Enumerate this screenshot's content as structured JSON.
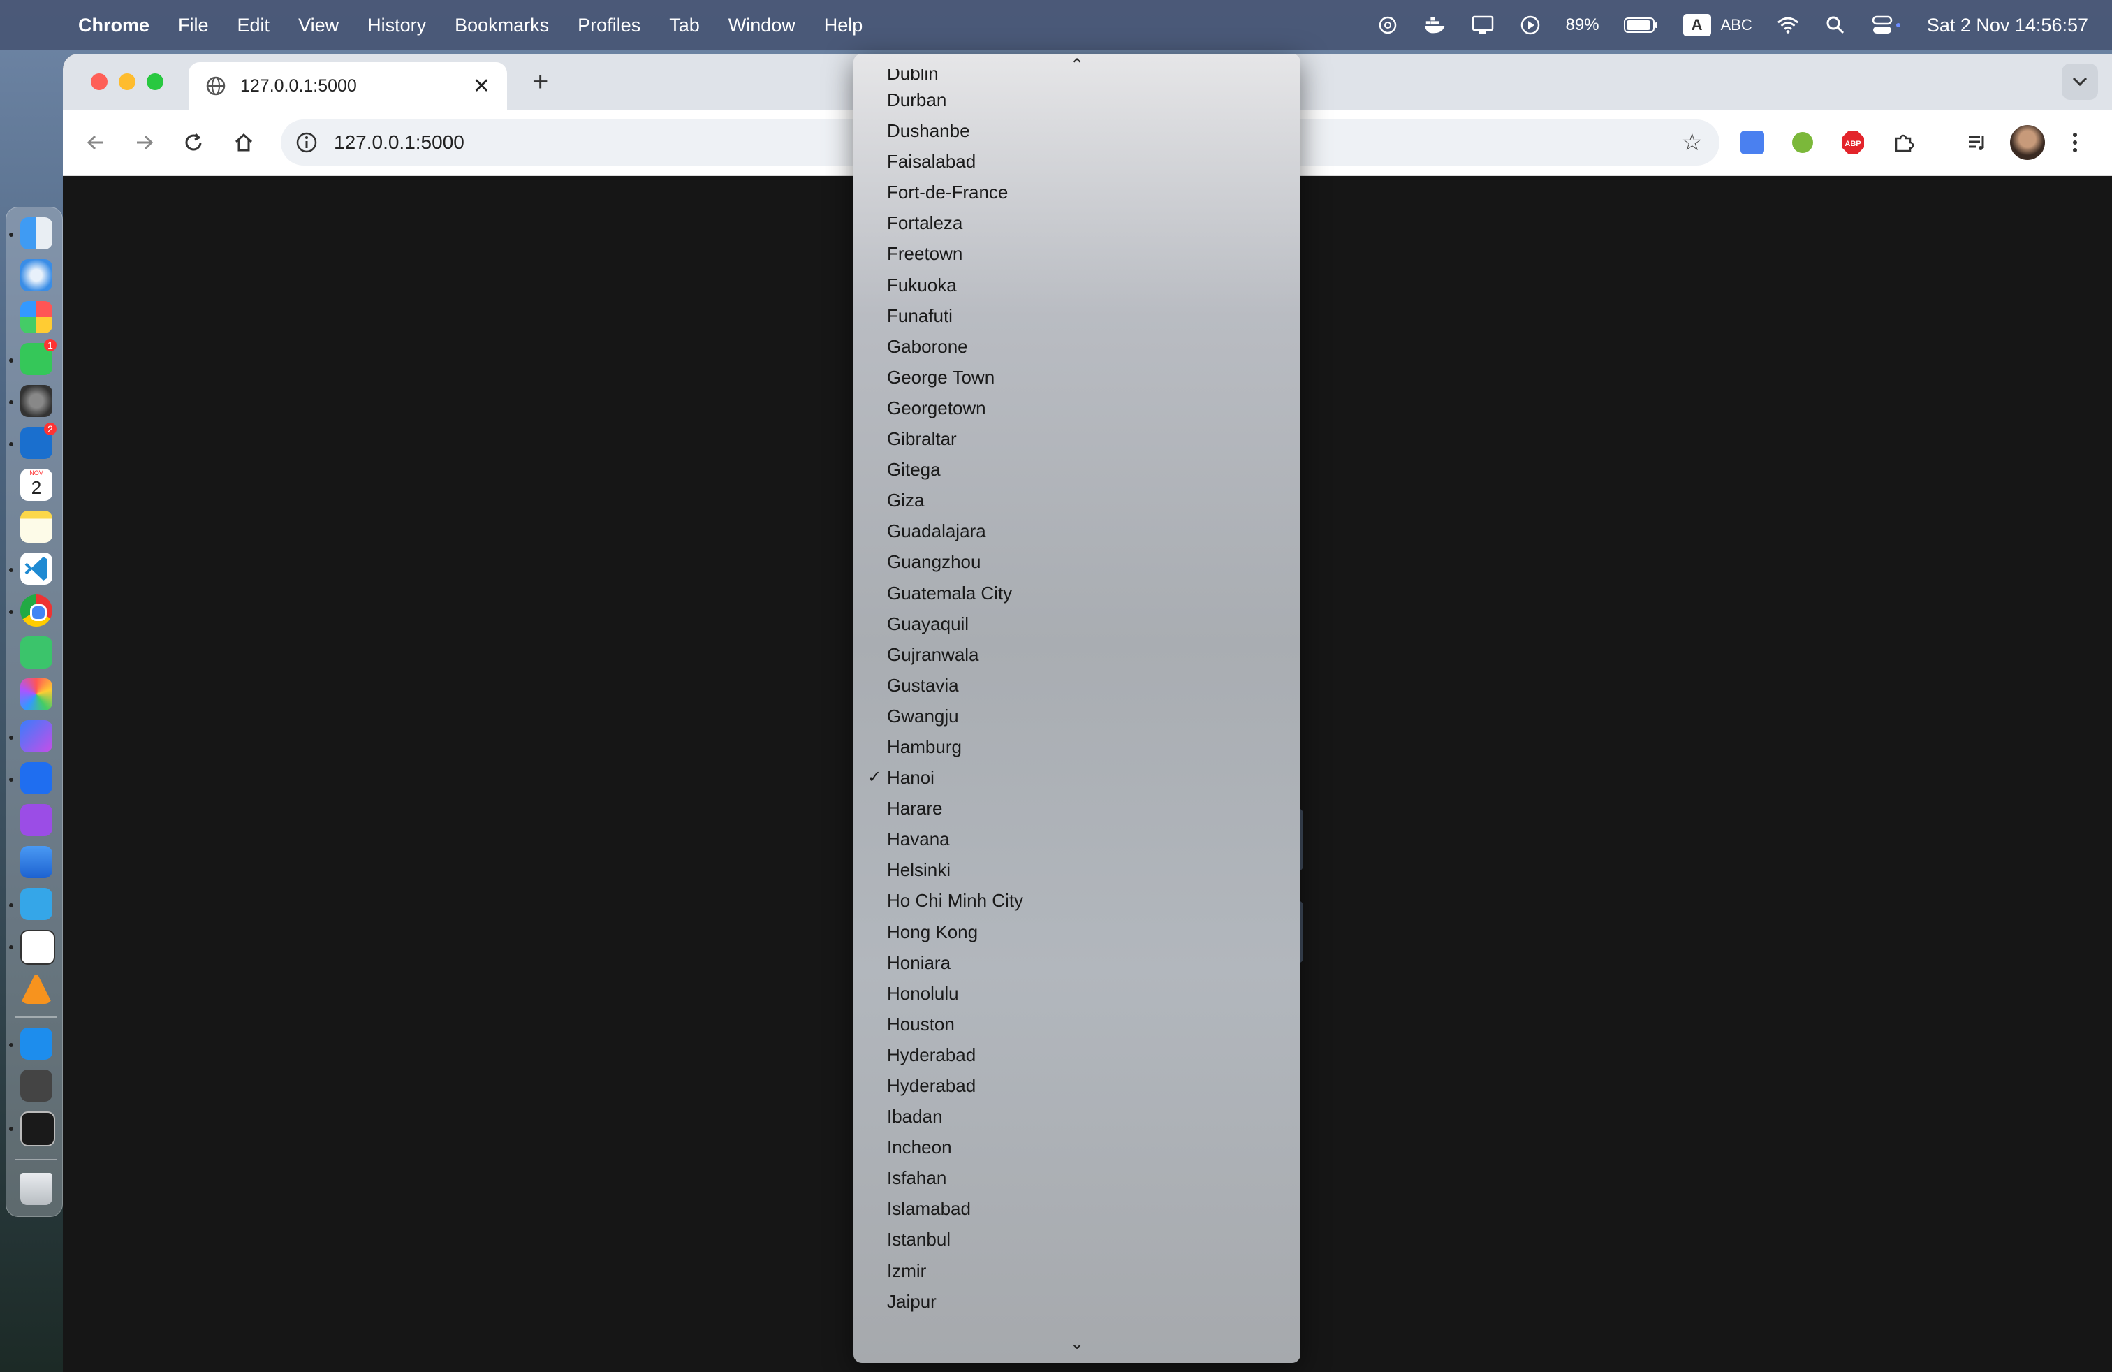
{
  "menubar": {
    "app_name": "Chrome",
    "items": [
      "File",
      "Edit",
      "View",
      "History",
      "Bookmarks",
      "Profiles",
      "Tab",
      "Window",
      "Help"
    ],
    "battery": "89%",
    "input_source": "ABC",
    "input_letter": "A",
    "datetime": "Sat 2 Nov  14:56:57"
  },
  "browser": {
    "tab_title": "127.0.0.1:5000",
    "url": "127.0.0.1:5000",
    "tab_close": "✕",
    "new_tab": "+"
  },
  "dropdown": {
    "selected": "Hanoi",
    "check_mark": "✓",
    "scroll_up": "⌃",
    "scroll_down": "⌄",
    "clipped_top": "Dublin",
    "options": [
      "Durban",
      "Dushanbe",
      "Faisalabad",
      "Fort-de-France",
      "Fortaleza",
      "Freetown",
      "Fukuoka",
      "Funafuti",
      "Gaborone",
      "George Town",
      "Georgetown",
      "Gibraltar",
      "Gitega",
      "Giza",
      "Guadalajara",
      "Guangzhou",
      "Guatemala City",
      "Guayaquil",
      "Gujranwala",
      "Gustavia",
      "Gwangju",
      "Hamburg",
      "Hanoi",
      "Harare",
      "Havana",
      "Helsinki",
      "Ho Chi Minh City",
      "Hong Kong",
      "Honiara",
      "Honolulu",
      "Houston",
      "Hyderabad",
      "Hyderabad",
      "Ibadan",
      "Incheon",
      "Isfahan",
      "Islamabad",
      "Istanbul",
      "Izmir",
      "Jaipur"
    ]
  },
  "dock": {
    "messages_badge": "1",
    "outlook_badge": "2",
    "calendar_month": "NOV",
    "calendar_day": "2"
  }
}
